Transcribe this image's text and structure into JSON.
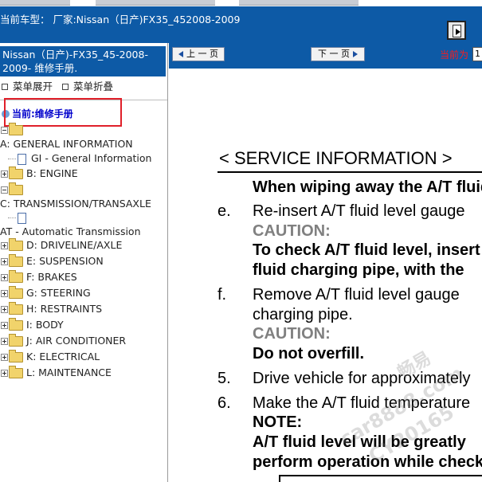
{
  "header": {
    "vehicle_line": "当前车型： 厂家:Nissan（日产)FX35_452008-2009"
  },
  "sidebar": {
    "manual_title": "Nissan（日产)-FX35_45-2008-2009- 维修手册.",
    "expand_label": "菜单展开",
    "collapse_label": "菜单折叠",
    "current_label": "当前:维修手册",
    "tree": [
      {
        "label": "A: GENERAL INFORMATION"
      },
      {
        "label": "GI - General Information"
      },
      {
        "label": "B: ENGINE"
      },
      {
        "label": "C: TRANSMISSION/TRANSAXLE"
      },
      {
        "label": "AT - Automatic Transmission"
      },
      {
        "label": "D: DRIVELINE/AXLE"
      },
      {
        "label": "E: SUSPENSION"
      },
      {
        "label": "F: BRAKES"
      },
      {
        "label": "G: STEERING"
      },
      {
        "label": "H: RESTRAINTS"
      },
      {
        "label": "I: BODY"
      },
      {
        "label": "J: AIR CONDITIONER"
      },
      {
        "label": "K: ELECTRICAL"
      },
      {
        "label": "L: MAINTENANCE"
      }
    ]
  },
  "nav": {
    "prev_label": "上 一 页",
    "next_label": "下 一 页",
    "current_page_label": "当前为",
    "page_value": "1"
  },
  "document": {
    "section_header": "< SERVICE INFORMATION >",
    "lines": [
      "When wiping away the A/T fluid",
      "Re-insert A/T fluid level gauge",
      "CAUTION:",
      "To check A/T fluid level, insert",
      "fluid charging pipe, with the",
      "Remove A/T fluid level gauge",
      "charging pipe.",
      "CAUTION:",
      "Do not overfill.",
      "Drive vehicle for approximately",
      "Make the A/T fluid temperature",
      "NOTE:",
      "A/T fluid level will be greatly",
      "perform operation while checking"
    ],
    "markers": [
      "e.",
      "f.",
      "5.",
      "6."
    ],
    "watermark": [
      "畅易",
      "car8888.com",
      "CY20165"
    ]
  },
  "colors": {
    "header_blue": "#0d5aa6",
    "highlight_red": "#e0202a",
    "current_blue": "#0000cc"
  }
}
